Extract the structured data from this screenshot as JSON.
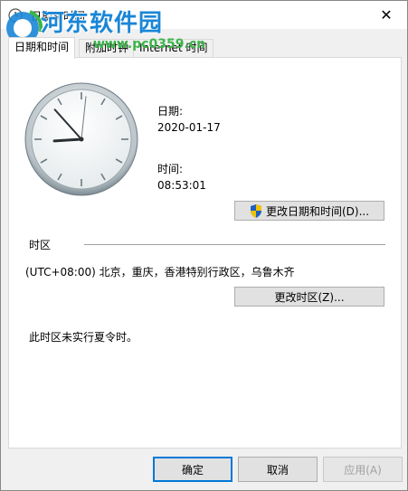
{
  "window": {
    "title": "日期和时间"
  },
  "watermark": {
    "brand": "河东软件园",
    "url": "www.pc0359.cn"
  },
  "tabs": [
    {
      "label": "日期和时间"
    },
    {
      "label": "附加时钟"
    },
    {
      "label": "Internet 时间"
    }
  ],
  "datetime": {
    "date_label": "日期:",
    "date_value": "2020-01-17",
    "time_label": "时间:",
    "time_value": "08:53:01",
    "change_datetime_button": "更改日期和时间(D)..."
  },
  "timezone": {
    "section_label": "时区",
    "value": "(UTC+08:00) 北京，重庆，香港特别行政区，乌鲁木齐",
    "change_button": "更改时区(Z)...",
    "dst_note": "此时区未实行夏令时。"
  },
  "footer": {
    "ok": "确定",
    "cancel": "取消",
    "apply": "应用(A)"
  },
  "clock": {
    "hour": 8,
    "minute": 53,
    "second": 1
  }
}
